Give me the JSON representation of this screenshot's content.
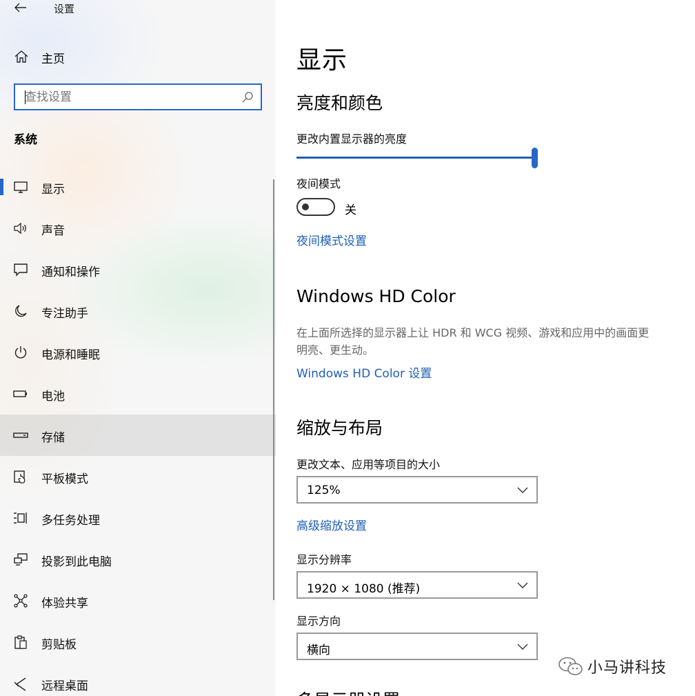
{
  "window": {
    "title": "设置"
  },
  "sidebar": {
    "home_label": "主页",
    "search": {
      "placeholder": "查找设置",
      "value": ""
    },
    "section_title": "系统",
    "items": [
      {
        "label": "显示",
        "icon": "monitor-icon",
        "selected": true
      },
      {
        "label": "声音",
        "icon": "speaker-icon"
      },
      {
        "label": "通知和操作",
        "icon": "notification-icon"
      },
      {
        "label": "专注助手",
        "icon": "moon-icon"
      },
      {
        "label": "电源和睡眠",
        "icon": "power-icon"
      },
      {
        "label": "电池",
        "icon": "battery-icon"
      },
      {
        "label": "存储",
        "icon": "storage-icon",
        "hovered": true
      },
      {
        "label": "平板模式",
        "icon": "tablet-mode-icon"
      },
      {
        "label": "多任务处理",
        "icon": "multitasking-icon"
      },
      {
        "label": "投影到此电脑",
        "icon": "project-icon"
      },
      {
        "label": "体验共享",
        "icon": "share-icon"
      },
      {
        "label": "剪贴板",
        "icon": "clipboard-icon"
      },
      {
        "label": "远程桌面",
        "icon": "remote-desktop-icon"
      }
    ]
  },
  "main": {
    "page_title": "显示",
    "brightness": {
      "heading": "亮度和颜色",
      "slider_label": "更改内置显示器的亮度",
      "slider_value_percent": 100,
      "night_mode_label": "夜间模式",
      "night_mode_state": "关",
      "night_mode_on": false,
      "night_mode_link": "夜间模式设置"
    },
    "hdr": {
      "heading": "Windows HD Color",
      "description_line1": "在上面所选择的显示器上让 HDR 和 WCG 视频、游戏和应用中的画面更",
      "description_line2": "明亮、更生动。",
      "link": "Windows HD Color 设置"
    },
    "scale": {
      "heading": "缩放与布局",
      "size_label": "更改文本、应用等项目的大小",
      "size_value": "125%",
      "advanced_link": "高级缩放设置",
      "resolution_label": "显示分辨率",
      "resolution_value": "1920 × 1080 (推荐)",
      "orientation_label": "显示方向",
      "orientation_value": "横向"
    },
    "partial_heading": "多显示器设置"
  },
  "watermark": {
    "text": "小马讲科技",
    "icon": "wechat-icon"
  },
  "colors": {
    "accent": "#2767c7",
    "link": "#1f5fb8"
  }
}
